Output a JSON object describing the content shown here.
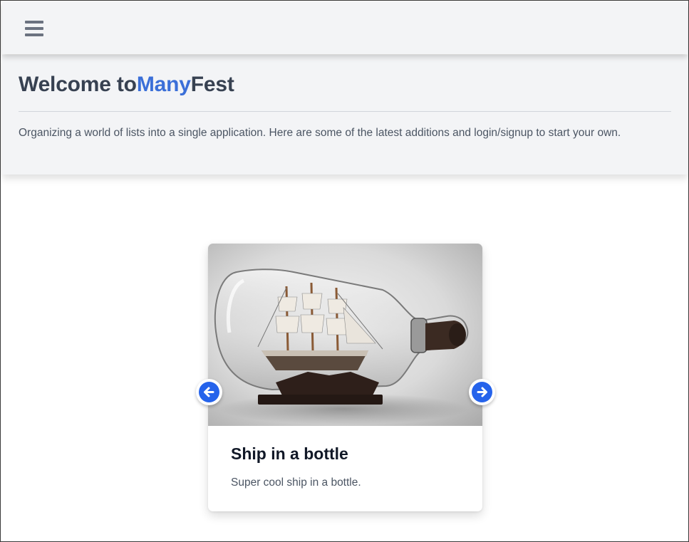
{
  "navbar": {
    "menu_icon": "hamburger-menu-icon"
  },
  "hero": {
    "title_prefix": "Welcome to",
    "title_brand": "Many",
    "title_suffix": "Fest",
    "description": "Organizing a world of lists into a single application. Here are some of the latest additions and login/signup to start your own."
  },
  "carousel": {
    "items": [
      {
        "title": "Ship in a bottle",
        "description": "Super cool ship in a bottle."
      }
    ],
    "prev_icon": "arrow-left-icon",
    "next_icon": "arrow-right-icon"
  },
  "colors": {
    "accent": "#3b6fd8",
    "button": "#2563eb",
    "panel_bg": "#f3f4f6",
    "title_text": "#374151"
  }
}
